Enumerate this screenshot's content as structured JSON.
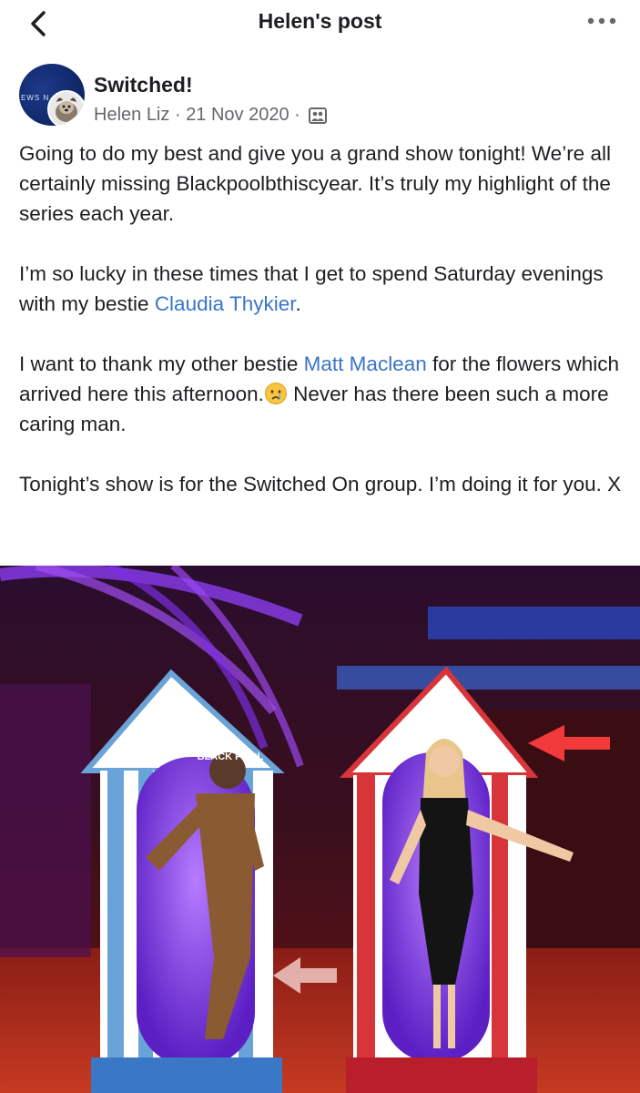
{
  "topbar": {
    "title": "Helen's post",
    "back_icon": "chevron-left-icon",
    "more_icon": "more-horizontal-icon"
  },
  "post": {
    "group_name": "Switched!",
    "avatar_text": "EWS N",
    "author": "Helen Liz",
    "separator": "·",
    "date": "21 Nov 2020",
    "audience_icon": "group-members-icon",
    "paragraphs": {
      "p1": "Going to do my best and give you a grand show tonight! We’re all certainly missing Blackpoolbthiscyear. It’s truly my highlight of the series each year.",
      "p2_before": "I’m so lucky in these times that I get to spend Saturday evenings with my bestie ",
      "p2_mention": "Claudia Thykier",
      "p2_after": ".",
      "p3_before": "I want to thank my other bestie ",
      "p3_mention": "Matt Maclean",
      "p3_middle": " for the flowers which arrived here this afternoon.",
      "p3_after": " Never has there been such a more caring man.",
      "p4": "Tonight’s show is for the Switched On group. I’m doing it for you. X"
    },
    "emoji_icon": "crying-face-emoji-icon",
    "photo": {
      "sign_text": "BLACK POOL",
      "colors": {
        "booth_left": "#6aa3d8",
        "booth_right": "#d8353a",
        "purple_glow": "#8b3df0"
      }
    }
  },
  "colors": {
    "link": "#3a74c9",
    "meta": "#65676b",
    "text": "#1c1e21"
  }
}
